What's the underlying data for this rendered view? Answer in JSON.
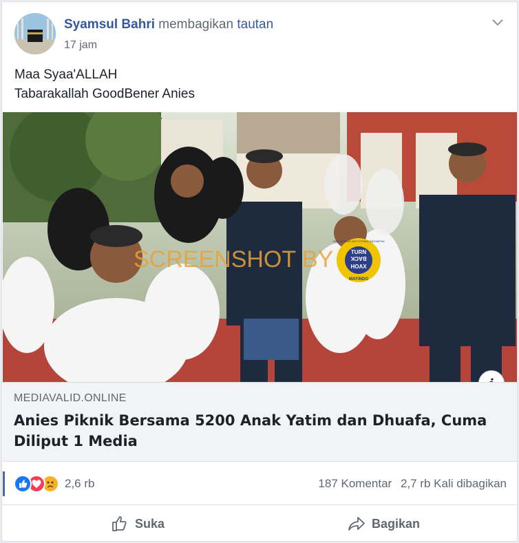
{
  "post": {
    "author": "Syamsul Bahri",
    "action_prefix": "membagikan",
    "action_link": "tautan",
    "time": "17 jam",
    "text_lines": [
      "Maa Syaa'ALLAH",
      "Tabarakallah GoodBener Anies"
    ]
  },
  "link": {
    "domain": "MEDIAVALID.ONLINE",
    "title": "Anies Piknik Bersama 5200 Anak Yatim dan Dhuafa, Cuma Diliput 1 Media",
    "image_watermark": "SCREENSHOT BY",
    "badge_lines": [
      "TURN",
      "BACK",
      "HOAX"
    ],
    "badge_ring_text": "MASYARAKAT ANTI FITNAH INDONESIA",
    "badge_bottom": "MAFINDO",
    "info_label": "i"
  },
  "stats": {
    "reaction_count": "2,6 rb",
    "comments": "187 Komentar",
    "shares": "2,7 rb Kali dibagikan"
  },
  "actions": {
    "like": "Suka",
    "share": "Bagikan"
  },
  "colors": {
    "brand_blue": "#365899",
    "like_blue": "#1877f2",
    "love_red": "#f33e58",
    "sad_yellow": "#f7b125"
  }
}
